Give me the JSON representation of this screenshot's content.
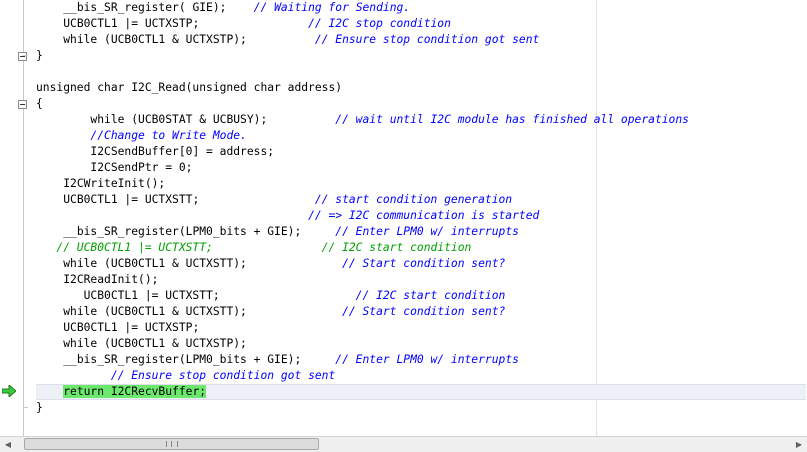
{
  "editor": {
    "lines": [
      {
        "indent": "    ",
        "code": "__bis_SR_register( GIE);",
        "gap": "    ",
        "comment": "// Waiting for Sending.",
        "style": "normal"
      },
      {
        "indent": "    ",
        "code": "UCB0CTL1 |= UCTXSTP;",
        "gap": "                ",
        "comment": "// I2C stop condition",
        "style": "normal"
      },
      {
        "indent": "    ",
        "code": "while (UCB0CTL1 & UCTXSTP);",
        "gap": "          ",
        "comment": "// Ensure stop condition got sent",
        "style": "normal"
      },
      {
        "indent": "",
        "code": "}",
        "gap": "",
        "comment": "",
        "style": "normal"
      },
      {
        "indent": "",
        "code": "",
        "gap": "",
        "comment": "",
        "style": "normal"
      },
      {
        "indent": "",
        "code": "unsigned char I2C_Read(unsigned char address)",
        "gap": "",
        "comment": "",
        "style": "normal"
      },
      {
        "indent": "",
        "code": "{",
        "gap": "",
        "comment": "",
        "style": "normal"
      },
      {
        "indent": "        ",
        "code": "while (UCB0STAT & UCBUSY);",
        "gap": "          ",
        "comment": "// wait until I2C module has finished all operations",
        "style": "normal"
      },
      {
        "indent": "        ",
        "code": "",
        "gap": "",
        "comment": "//Change to Write Mode.",
        "style": "normal"
      },
      {
        "indent": "        ",
        "code": "I2CSendBuffer[0] = address;",
        "gap": "",
        "comment": "",
        "style": "normal"
      },
      {
        "indent": "        ",
        "code": "I2CSendPtr = 0;",
        "gap": "",
        "comment": "",
        "style": "normal"
      },
      {
        "indent": "    ",
        "code": "I2CWriteInit();",
        "gap": "",
        "comment": "",
        "style": "normal"
      },
      {
        "indent": "    ",
        "code": "UCB0CTL1 |= UCTXSTT;",
        "gap": "                 ",
        "comment": "// start condition generation",
        "style": "normal"
      },
      {
        "indent": "",
        "code": "",
        "gap": "                                        ",
        "comment": "// => I2C communication is started",
        "style": "normal"
      },
      {
        "indent": "    ",
        "code": "__bis_SR_register(LPM0_bits + GIE);",
        "gap": "     ",
        "comment": "// Enter LPM0 w/ interrupts",
        "style": "normal"
      },
      {
        "indent": "   ",
        "code": "// UCB0CTL1 |= UCTXSTT;",
        "gap": "                ",
        "comment": "// I2C start condition",
        "style": "green"
      },
      {
        "indent": "    ",
        "code": "while (UCB0CTL1 & UCTXSTT);",
        "gap": "              ",
        "comment": "// Start condition sent?",
        "style": "normal"
      },
      {
        "indent": "    ",
        "code": "I2CReadInit();",
        "gap": "",
        "comment": "",
        "style": "normal"
      },
      {
        "indent": "       ",
        "code": "UCB0CTL1 |= UCTXSTT;",
        "gap": "                    ",
        "comment": "// I2C start condition",
        "style": "normal"
      },
      {
        "indent": "    ",
        "code": "while (UCB0CTL1 & UCTXSTT);",
        "gap": "              ",
        "comment": "// Start condition sent?",
        "style": "normal"
      },
      {
        "indent": "    ",
        "code": "UCB0CTL1 |= UCTXSTP;",
        "gap": "",
        "comment": "",
        "style": "normal"
      },
      {
        "indent": "    ",
        "code": "while (UCB0CTL1 & UCTXSTP);",
        "gap": "",
        "comment": "",
        "style": "normal"
      },
      {
        "indent": "    ",
        "code": "__bis_SR_register(LPM0_bits + GIE);",
        "gap": "     ",
        "comment": "// Enter LPM0 w/ interrupts",
        "style": "normal"
      },
      {
        "indent": "           ",
        "code": "",
        "gap": "",
        "comment": "// Ensure stop condition got sent",
        "style": "normal"
      },
      {
        "indent": "    ",
        "code": "return I2CRecvBuffer;",
        "gap": "",
        "comment": "",
        "style": "current"
      },
      {
        "indent": "",
        "code": "}",
        "gap": "",
        "comment": "",
        "style": "normal"
      }
    ]
  },
  "icons": {
    "execution_arrow": "green-arrow-right-icon",
    "fold_marker": "minus-box-icon",
    "scroll_left": "chevron-left-icon",
    "scroll_right": "chevron-right-icon"
  },
  "colors": {
    "keyword": "#000000",
    "comment": "#0000ff",
    "disabled_code": "#00a000",
    "current_statement": "#6ce86c",
    "arrow": "#3cc83c"
  },
  "scrollbar": {
    "left_glyph": "◀",
    "right_glyph": "▶"
  }
}
